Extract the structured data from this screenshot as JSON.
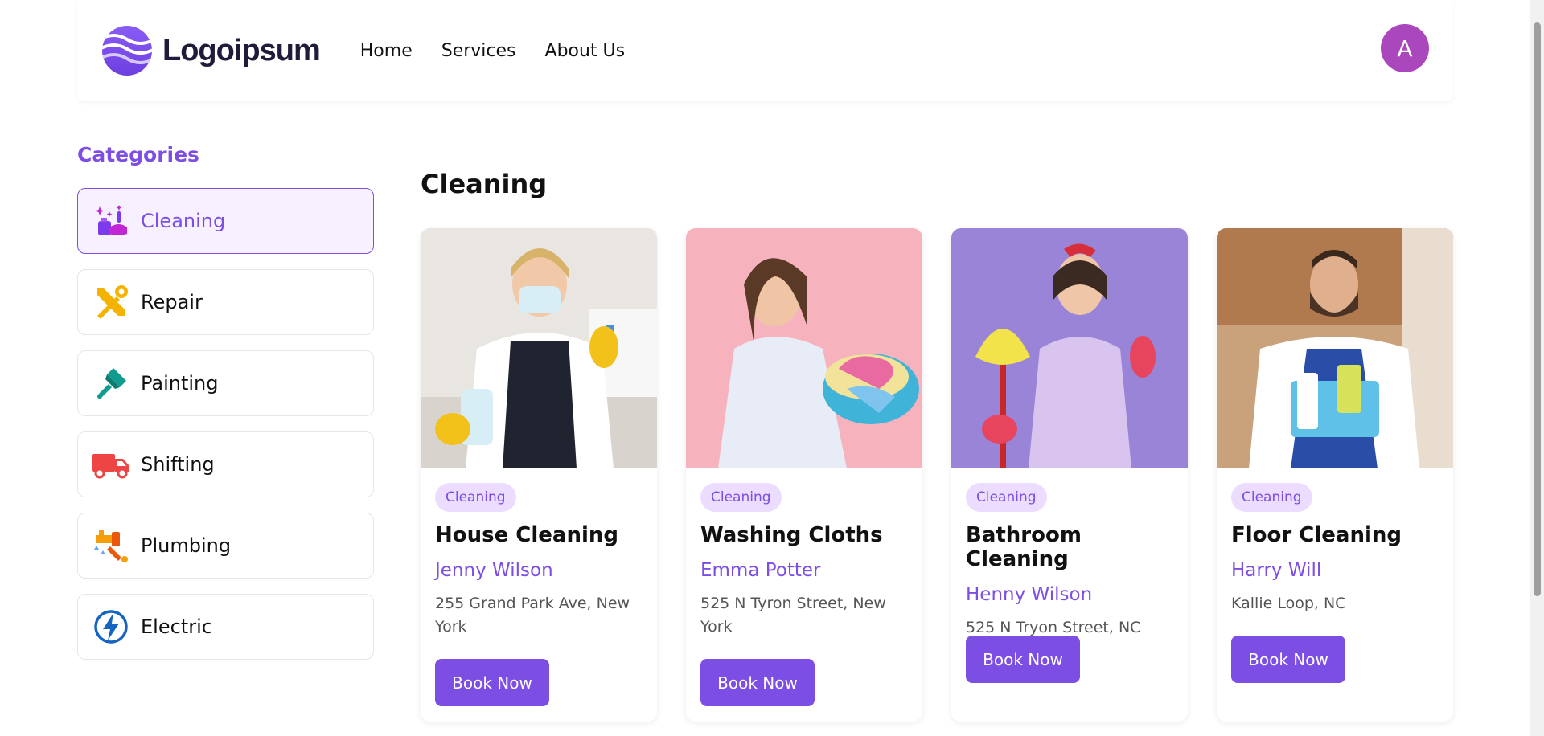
{
  "header": {
    "logo_text": "Logoipsum",
    "nav": [
      "Home",
      "Services",
      "About Us"
    ],
    "avatar_letter": "A"
  },
  "sidebar": {
    "title": "Categories",
    "items": [
      {
        "label": "Cleaning",
        "icon": "cleaning-icon",
        "active": true
      },
      {
        "label": "Repair",
        "icon": "repair-tools-icon",
        "active": false
      },
      {
        "label": "Painting",
        "icon": "paint-brush-icon",
        "active": false
      },
      {
        "label": "Shifting",
        "icon": "truck-icon",
        "active": false
      },
      {
        "label": "Plumbing",
        "icon": "plumbing-icon",
        "active": false
      },
      {
        "label": "Electric",
        "icon": "lightning-icon",
        "active": false
      }
    ]
  },
  "main": {
    "title": "Cleaning",
    "cards": [
      {
        "tag": "Cleaning",
        "title": "House Cleaning",
        "person": "Jenny Wilson",
        "address": "255 Grand Park Ave, New York",
        "button": "Book Now"
      },
      {
        "tag": "Cleaning",
        "title": "Washing Cloths",
        "person": "Emma Potter",
        "address": "525 N Tyron Street, New York",
        "button": "Book Now"
      },
      {
        "tag": "Cleaning",
        "title": "Bathroom Cleaning",
        "person": "Henny Wilson",
        "address": "525 N Tryon Street, NC",
        "button": "Book Now"
      },
      {
        "tag": "Cleaning",
        "title": "Floor Cleaning",
        "person": "Harry Will",
        "address": "Kallie Loop, NC",
        "button": "Book Now"
      }
    ]
  },
  "colors": {
    "accent": "#7c4ee4",
    "active_bg": "#f7f0ff",
    "tag_bg": "#ecdcff",
    "avatar": "#ab47bc"
  }
}
